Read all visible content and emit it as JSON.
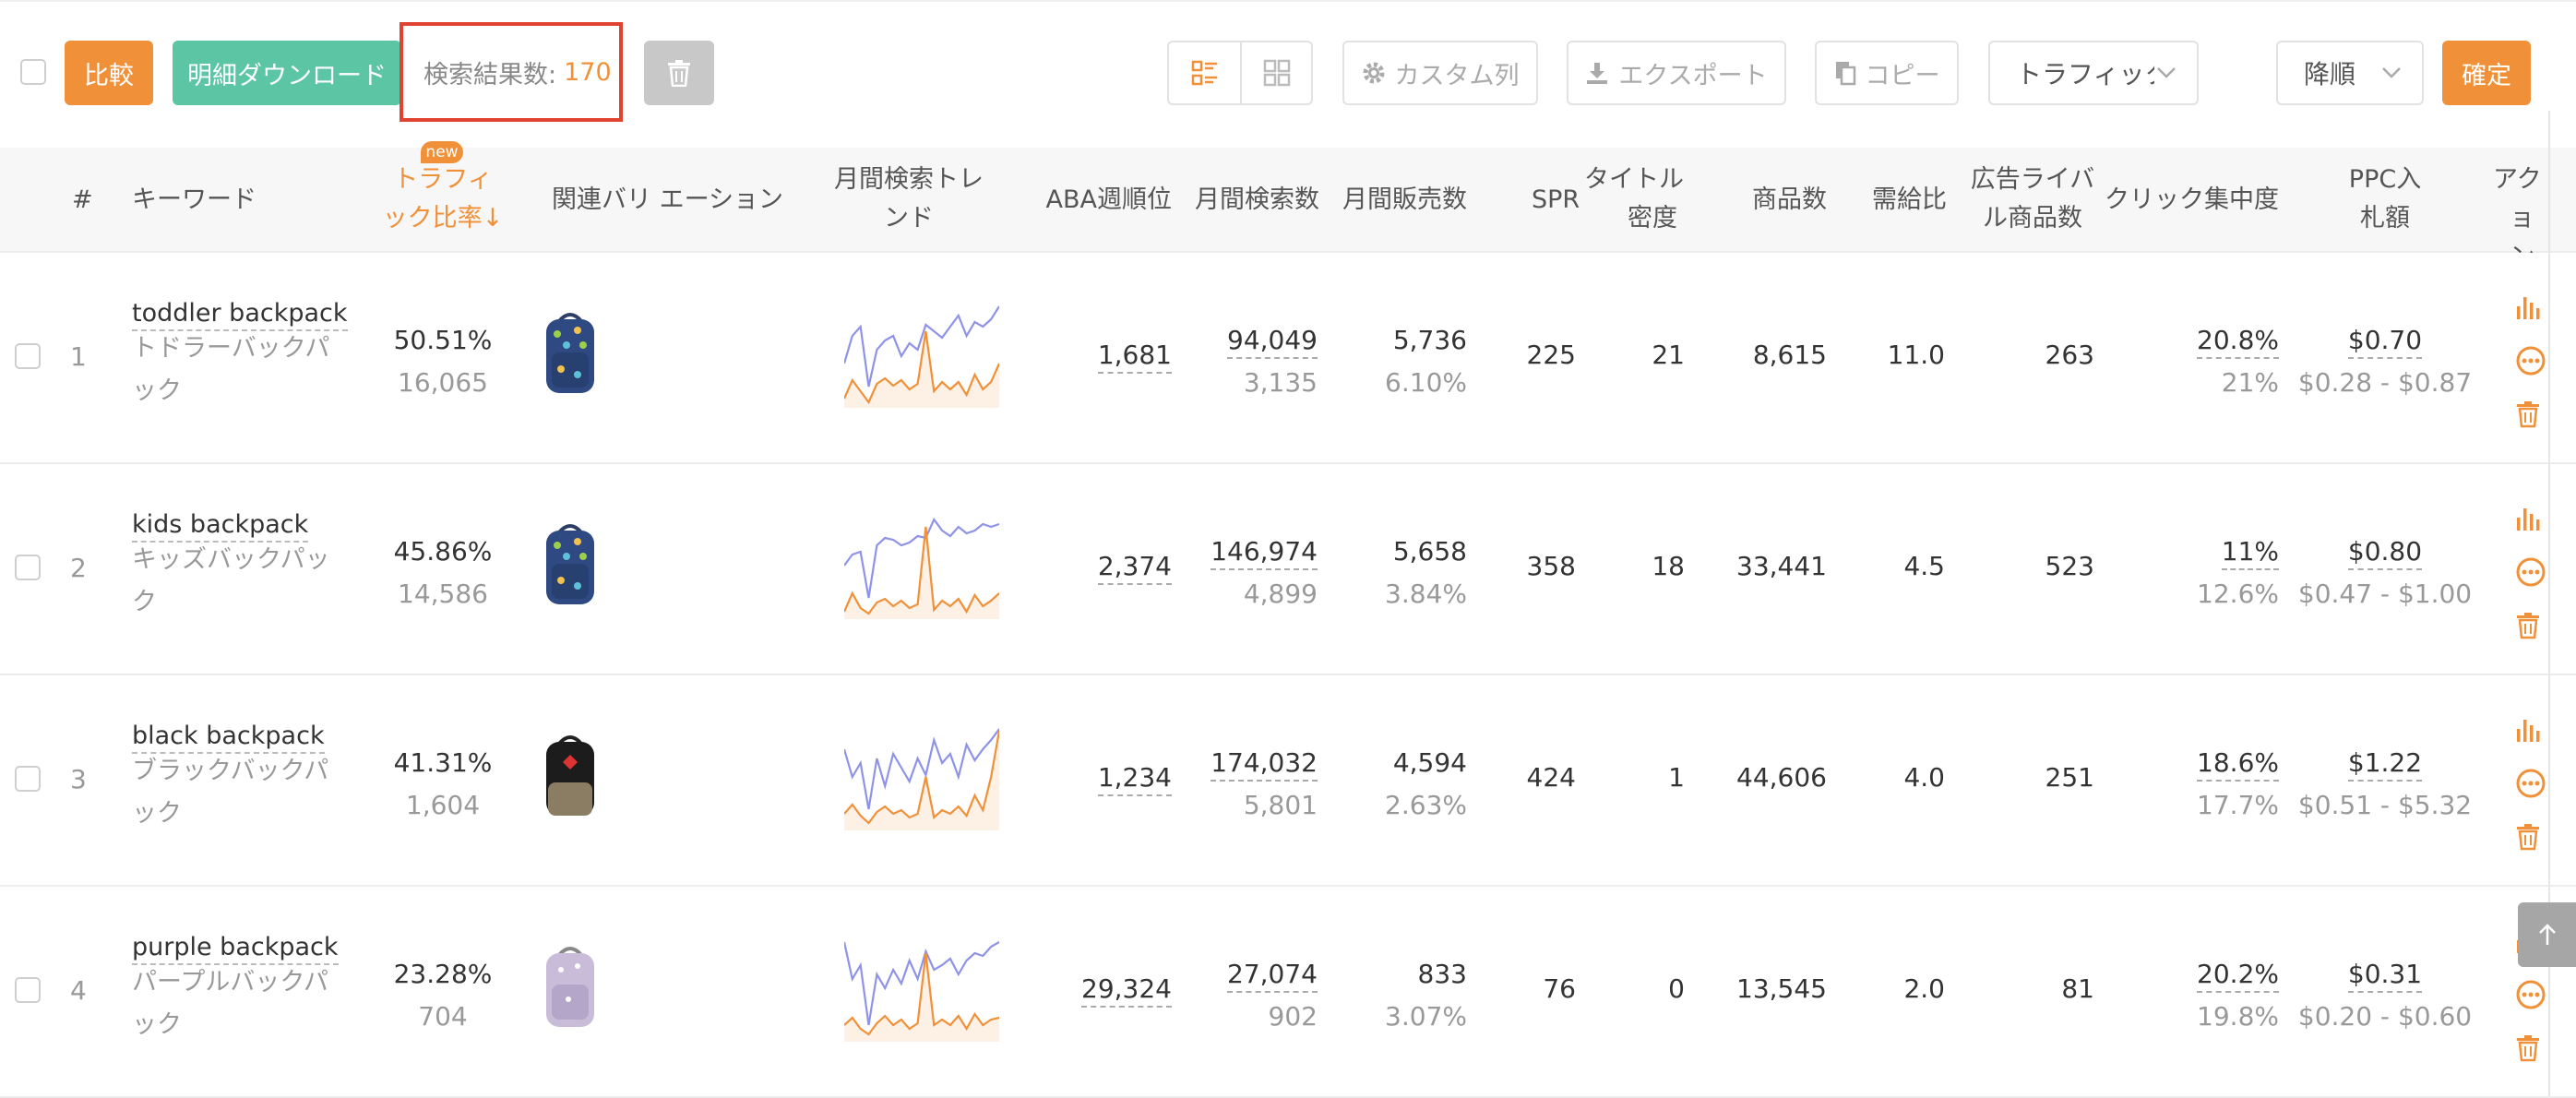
{
  "toolbar": {
    "compare_label": "比較",
    "download_label": "明細ダウンロード",
    "result_label": "検索結果数:",
    "result_count": "170",
    "custom_columns_label": "カスタム列",
    "export_label": "エクスポート",
    "copy_label": "コピー",
    "sort_field_value": "トラフィック比",
    "sort_order_value": "降順",
    "confirm_label": "確定"
  },
  "table": {
    "new_badge": "new",
    "headers": {
      "index": "#",
      "keyword": "キーワード",
      "traffic_ratio_1": "トラフィ",
      "traffic_ratio_2": "ック比率↓",
      "variation": "関連バリ エーション",
      "trend_1": "月間検索トレ",
      "trend_2": "ンド",
      "aba_rank": "ABA週順位",
      "monthly_search": "月間検索数",
      "monthly_sales": "月間販売数",
      "spr": "SPR",
      "title_density_1": "タイトル",
      "title_density_2": "密度",
      "product_count": "商品数",
      "supply_demand": "需給比",
      "ad_rivals_1": "広告ライバ",
      "ad_rivals_2": "ル商品数",
      "click_concentration": "クリック集中度",
      "ppc_1": "PPC入",
      "ppc_2": "札額",
      "actions_1": "アク",
      "actions_2": "ョン"
    },
    "rows": [
      {
        "num": "1",
        "keyword_en": "toddler backpack",
        "keyword_jp": "トドラーバックパック",
        "traffic_pct": "50.51%",
        "traffic_sub": "16,065",
        "image": "dinosaur-backpack",
        "aba": "1,681",
        "search": "94,049",
        "search_sub": "3,135",
        "sales": "5,736",
        "sales_sub": "6.10%",
        "spr": "225",
        "title_density": "21",
        "products": "8,615",
        "supply_demand": "11.0",
        "ad_rivals": "263",
        "click": "20.8%",
        "click_sub": "21%",
        "ppc": "$0.70",
        "ppc_range": "$0.28 - $0.87",
        "trend_blue": [
          70,
          40,
          30,
          95,
          55,
          45,
          40,
          62,
          48,
          55,
          28,
          35,
          42,
          30,
          18,
          40,
          25,
          30,
          22,
          8
        ],
        "trend_orange": [
          108,
          88,
          100,
          112,
          92,
          86,
          94,
          88,
          98,
          92,
          35,
          100,
          90,
          98,
          90,
          104,
          82,
          98,
          90,
          70
        ]
      },
      {
        "num": "2",
        "keyword_en": "kids backpack",
        "keyword_jp": "キッズバックパック",
        "traffic_pct": "45.86%",
        "traffic_sub": "14,586",
        "image": "dinosaur-backpack",
        "aba": "2,374",
        "search": "146,974",
        "search_sub": "4,899",
        "sales": "5,658",
        "sales_sub": "3.84%",
        "spr": "358",
        "title_density": "18",
        "products": "33,441",
        "supply_demand": "4.5",
        "ad_rivals": "523",
        "click": "11%",
        "click_sub": "12.6%",
        "ppc": "$0.80",
        "ppc_range": "$0.47 - $1.00",
        "trend_blue": [
          60,
          48,
          45,
          95,
          38,
          30,
          32,
          38,
          35,
          28,
          30,
          10,
          22,
          28,
          18,
          25,
          22,
          15,
          18,
          15
        ],
        "trend_orange": [
          110,
          90,
          106,
          112,
          100,
          96,
          104,
          98,
          106,
          102,
          18,
          108,
          98,
          104,
          96,
          110,
          92,
          104,
          98,
          90
        ]
      },
      {
        "num": "3",
        "keyword_en": "black backpack",
        "keyword_jp": "ブラックバックパック",
        "traffic_pct": "41.31%",
        "traffic_sub": "1,604",
        "image": "black-backpack",
        "aba": "1,234",
        "search": "174,032",
        "search_sub": "5,801",
        "sales": "4,594",
        "sales_sub": "2.63%",
        "spr": "424",
        "title_density": "1",
        "products": "44,606",
        "supply_demand": "4.0",
        "ad_rivals": "251",
        "click": "18.6%",
        "click_sub": "17.7%",
        "ppc": "$1.22",
        "ppc_range": "$0.51 - $5.32",
        "trend_blue": [
          30,
          60,
          45,
          95,
          40,
          70,
          35,
          50,
          65,
          40,
          58,
          20,
          45,
          35,
          60,
          25,
          42,
          30,
          20,
          8
        ],
        "trend_orange": [
          100,
          90,
          102,
          110,
          98,
          92,
          100,
          96,
          104,
          100,
          60,
          104,
          96,
          100,
          92,
          102,
          80,
          96,
          60,
          10
        ]
      },
      {
        "num": "4",
        "keyword_en": "purple backpack",
        "keyword_jp": "パープルバックパック",
        "traffic_pct": "23.28%",
        "traffic_sub": "704",
        "image": "lavender-backpack",
        "aba": "29,324",
        "search": "27,074",
        "search_sub": "902",
        "sales": "833",
        "sales_sub": "3.07%",
        "spr": "76",
        "title_density": "0",
        "products": "13,545",
        "supply_demand": "2.0",
        "ad_rivals": "81",
        "click": "20.2%",
        "click_sub": "19.8%",
        "ppc": "$0.31",
        "ppc_range": "$0.20 - $0.60",
        "trend_blue": [
          10,
          50,
          35,
          100,
          45,
          60,
          40,
          55,
          30,
          50,
          20,
          40,
          35,
          28,
          45,
          30,
          22,
          25,
          15,
          10
        ],
        "trend_orange": [
          100,
          92,
          104,
          110,
          98,
          90,
          100,
          94,
          104,
          98,
          22,
          100,
          94,
          100,
          90,
          104,
          88,
          100,
          94,
          92
        ]
      }
    ]
  },
  "colors": {
    "accent": "#f0913a",
    "green": "#5cc5a4",
    "highlight": "#e0432f",
    "trend_blue": "#8f93e8",
    "trend_orange": "#f0913a"
  },
  "icons": [
    "trash-icon",
    "list-view-icon",
    "grid-view-icon",
    "gear-icon",
    "download-icon",
    "copy-icon",
    "chevron-down-icon",
    "bar-chart-icon",
    "more-icon",
    "arrow-up-icon"
  ]
}
